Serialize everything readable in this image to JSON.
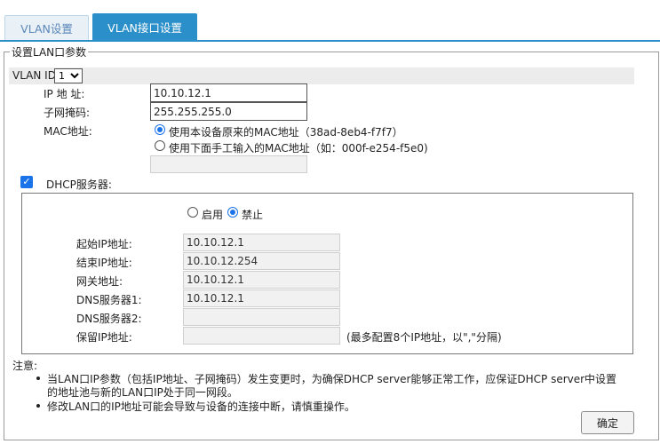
{
  "tabs": {
    "vlan_settings": "VLAN设置",
    "vlan_interface": "VLAN接口设置"
  },
  "lan": {
    "legend": "设置LAN口参数",
    "vlan_id_label": "VLAN ID",
    "vlan_id_value": "1",
    "ip_label": "IP 地 址:",
    "ip_value": "10.10.12.1",
    "mask_label": "子网掩码:",
    "mask_value": "255.255.255.0",
    "mac_label": "MAC地址:",
    "mac_option_original": "使用本设备原来的MAC地址（38ad-8eb4-f7f7）",
    "mac_option_manual": "使用下面手工输入的MAC地址（如：000f-e254-f5e0)",
    "mac_manual_value": ""
  },
  "dhcp": {
    "label": "DHCP服务器:",
    "checked": true,
    "enable_label": "启用",
    "disable_label": "禁止",
    "mode": "disable",
    "start_ip_label": "起始IP地址:",
    "start_ip_value": "10.10.12.1",
    "end_ip_label": "结束IP地址:",
    "end_ip_value": "10.10.12.254",
    "gateway_label": "网关地址:",
    "gateway_value": "10.10.12.1",
    "dns1_label": "DNS服务器1:",
    "dns1_value": "10.10.12.1",
    "dns2_label": "DNS服务器2:",
    "dns2_value": "",
    "reserved_label": "保留IP地址:",
    "reserved_value": "",
    "reserved_hint": "(最多配置8个IP地址，以\",\"分隔)"
  },
  "notes": {
    "title": "注意:",
    "item1_line1": "当LAN口IP参数（包括IP地址、子网掩码）发生变更时，为确保DHCP server能够正常工作，应保证DHCP server中设置",
    "item1_line2": "的地址池与新的LAN口IP处于同一网段。",
    "item2": "修改LAN口的IP地址可能会导致与设备的连接中断，请慎重操作。"
  },
  "confirm_label": "确定",
  "colors": {
    "accent": "#2b8fc9",
    "radio": "#1a73e8"
  }
}
